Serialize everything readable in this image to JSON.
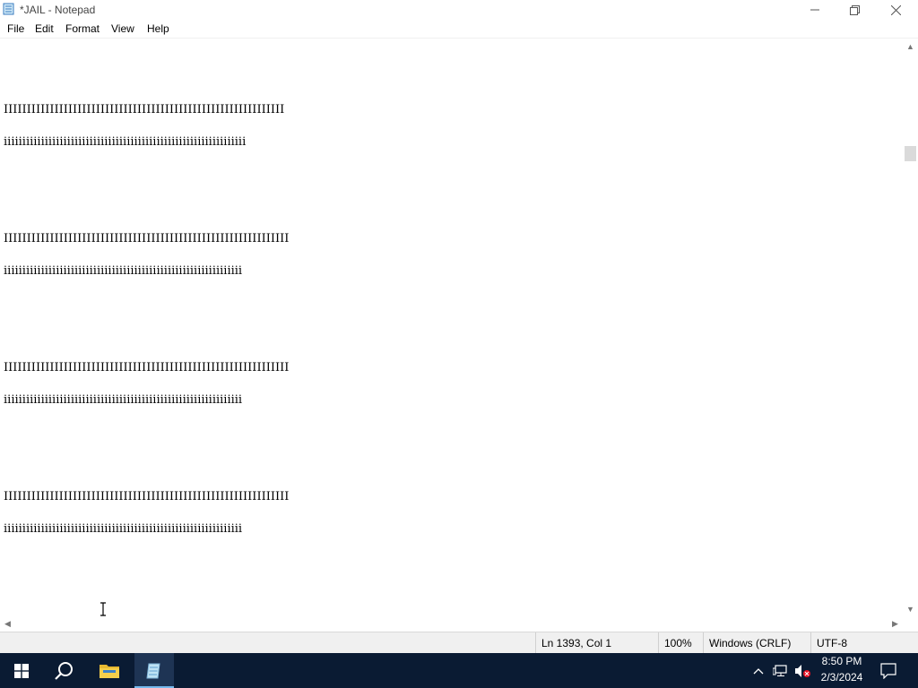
{
  "window": {
    "title": "*JAIL - Notepad",
    "controls": [
      "minimize",
      "restore",
      "close"
    ]
  },
  "menu": {
    "items": [
      "File",
      "Edit",
      "Format",
      "View",
      "Help"
    ]
  },
  "editor": {
    "lines": [
      "IIIIIIIIIIIIIIIIIIIIIIIIIIIIIIIIIIIIIIIIIIIIIIIIIIIIIIIIIIIII",
      "iiiiiiiiiiiiiiiiiiiiiiiiiiiiiiiiiiiiiiiiiiiiiiiiiiiiiiiiiiiiiiiii",
      "IIIIIIIIIIIIIIIIIIIIIIIIIIIIIIIIIIIIIIIIIIIIIIIIIIIIIIIIIIIIII",
      "iiiiiiiiiiiiiiiiiiiiiiiiiiiiiiiiiiiiiiiiiiiiiiiiiiiiiiiiiiiiiiii",
      "IIIIIIIIIIIIIIIIIIIIIIIIIIIIIIIIIIIIIIIIIIIIIIIIIIIIIIIIIIIIII",
      "iiiiiiiiiiiiiiiiiiiiiiiiiiiiiiiiiiiiiiiiiiiiiiiiiiiiiiiiiiiiiiii",
      "IIIIIIIIIIIIIIIIIIIIIIIIIIIIIIIIIIIIIIIIIIIIIIIIIIIIIIIIIIIIII",
      "iiiiiiiiiiiiiiiiiiiiiiiiiiiiiiiiiiiiiiiiiiiiiiiiiiiiiiiiiiiiiiii"
    ]
  },
  "status": {
    "position": "Ln 1393, Col 1",
    "zoom": "100%",
    "line_ending": "Windows (CRLF)",
    "encoding": "UTF-8"
  },
  "taskbar": {
    "time": "8:50 PM",
    "date": "2/3/2024",
    "icons": [
      "windows-start-icon",
      "search-icon",
      "file-explorer-icon",
      "notepad-icon"
    ]
  },
  "colors": {
    "taskbar_bg": "#0a1b33",
    "statusbar_bg": "#f0f0f0",
    "active_app_indicator": "#76b9ed"
  }
}
